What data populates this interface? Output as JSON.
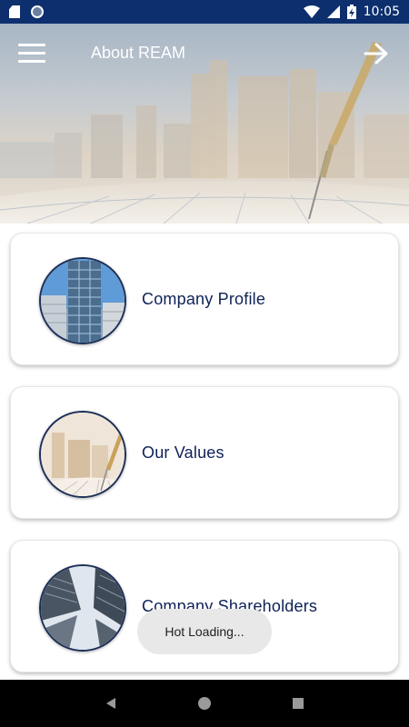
{
  "status_bar": {
    "time": "10:05",
    "icons": [
      "sd-card-icon",
      "notification-icon",
      "wifi-icon",
      "signal-icon",
      "battery-charging-icon"
    ]
  },
  "header": {
    "title": "About REAM",
    "menu_icon": "hamburger-menu-icon",
    "action_icon": "arrow-right-icon"
  },
  "cards": [
    {
      "label": "Company Profile",
      "image": "office-building-photo"
    },
    {
      "label": "Our Values",
      "image": "dart-city-photo"
    },
    {
      "label": "Company Shareholders",
      "image": "skyscrapers-photo"
    }
  ],
  "toast": {
    "text": "Hot Loading..."
  },
  "nav_bar": {
    "icons": [
      "back-icon",
      "home-icon",
      "recents-icon"
    ]
  },
  "colors": {
    "status_bar": "#0d2f6e",
    "card_text": "#0f2157",
    "nav_bar": "#000000"
  }
}
